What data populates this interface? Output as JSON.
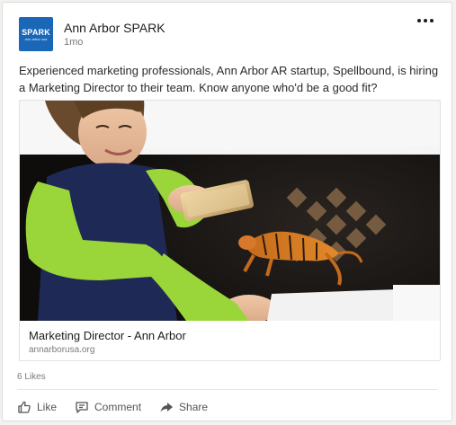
{
  "post": {
    "author": "Ann Arbor SPARK",
    "time": "1mo",
    "logo_text": "SPARK",
    "logo_subtext": "ann arbor usa",
    "text": "Experienced marketing professionals, Ann Arbor AR startup, Spellbound, is hiring a Marketing Director to their team. Know anyone who'd be a good fit?",
    "link": {
      "title": "Marketing Director - Ann Arbor",
      "domain": "annarborusa.org"
    },
    "likes": "6 Likes"
  },
  "actions": {
    "like": "Like",
    "comment": "Comment",
    "share": "Share"
  },
  "icons": {
    "more": "more-options-icon",
    "like": "thumbs-up-icon",
    "comment": "comment-icon",
    "share": "share-arrow-icon"
  },
  "colors": {
    "brand": "#1a66b7",
    "text": "#1d1d1d",
    "muted": "#7a7a7a"
  }
}
